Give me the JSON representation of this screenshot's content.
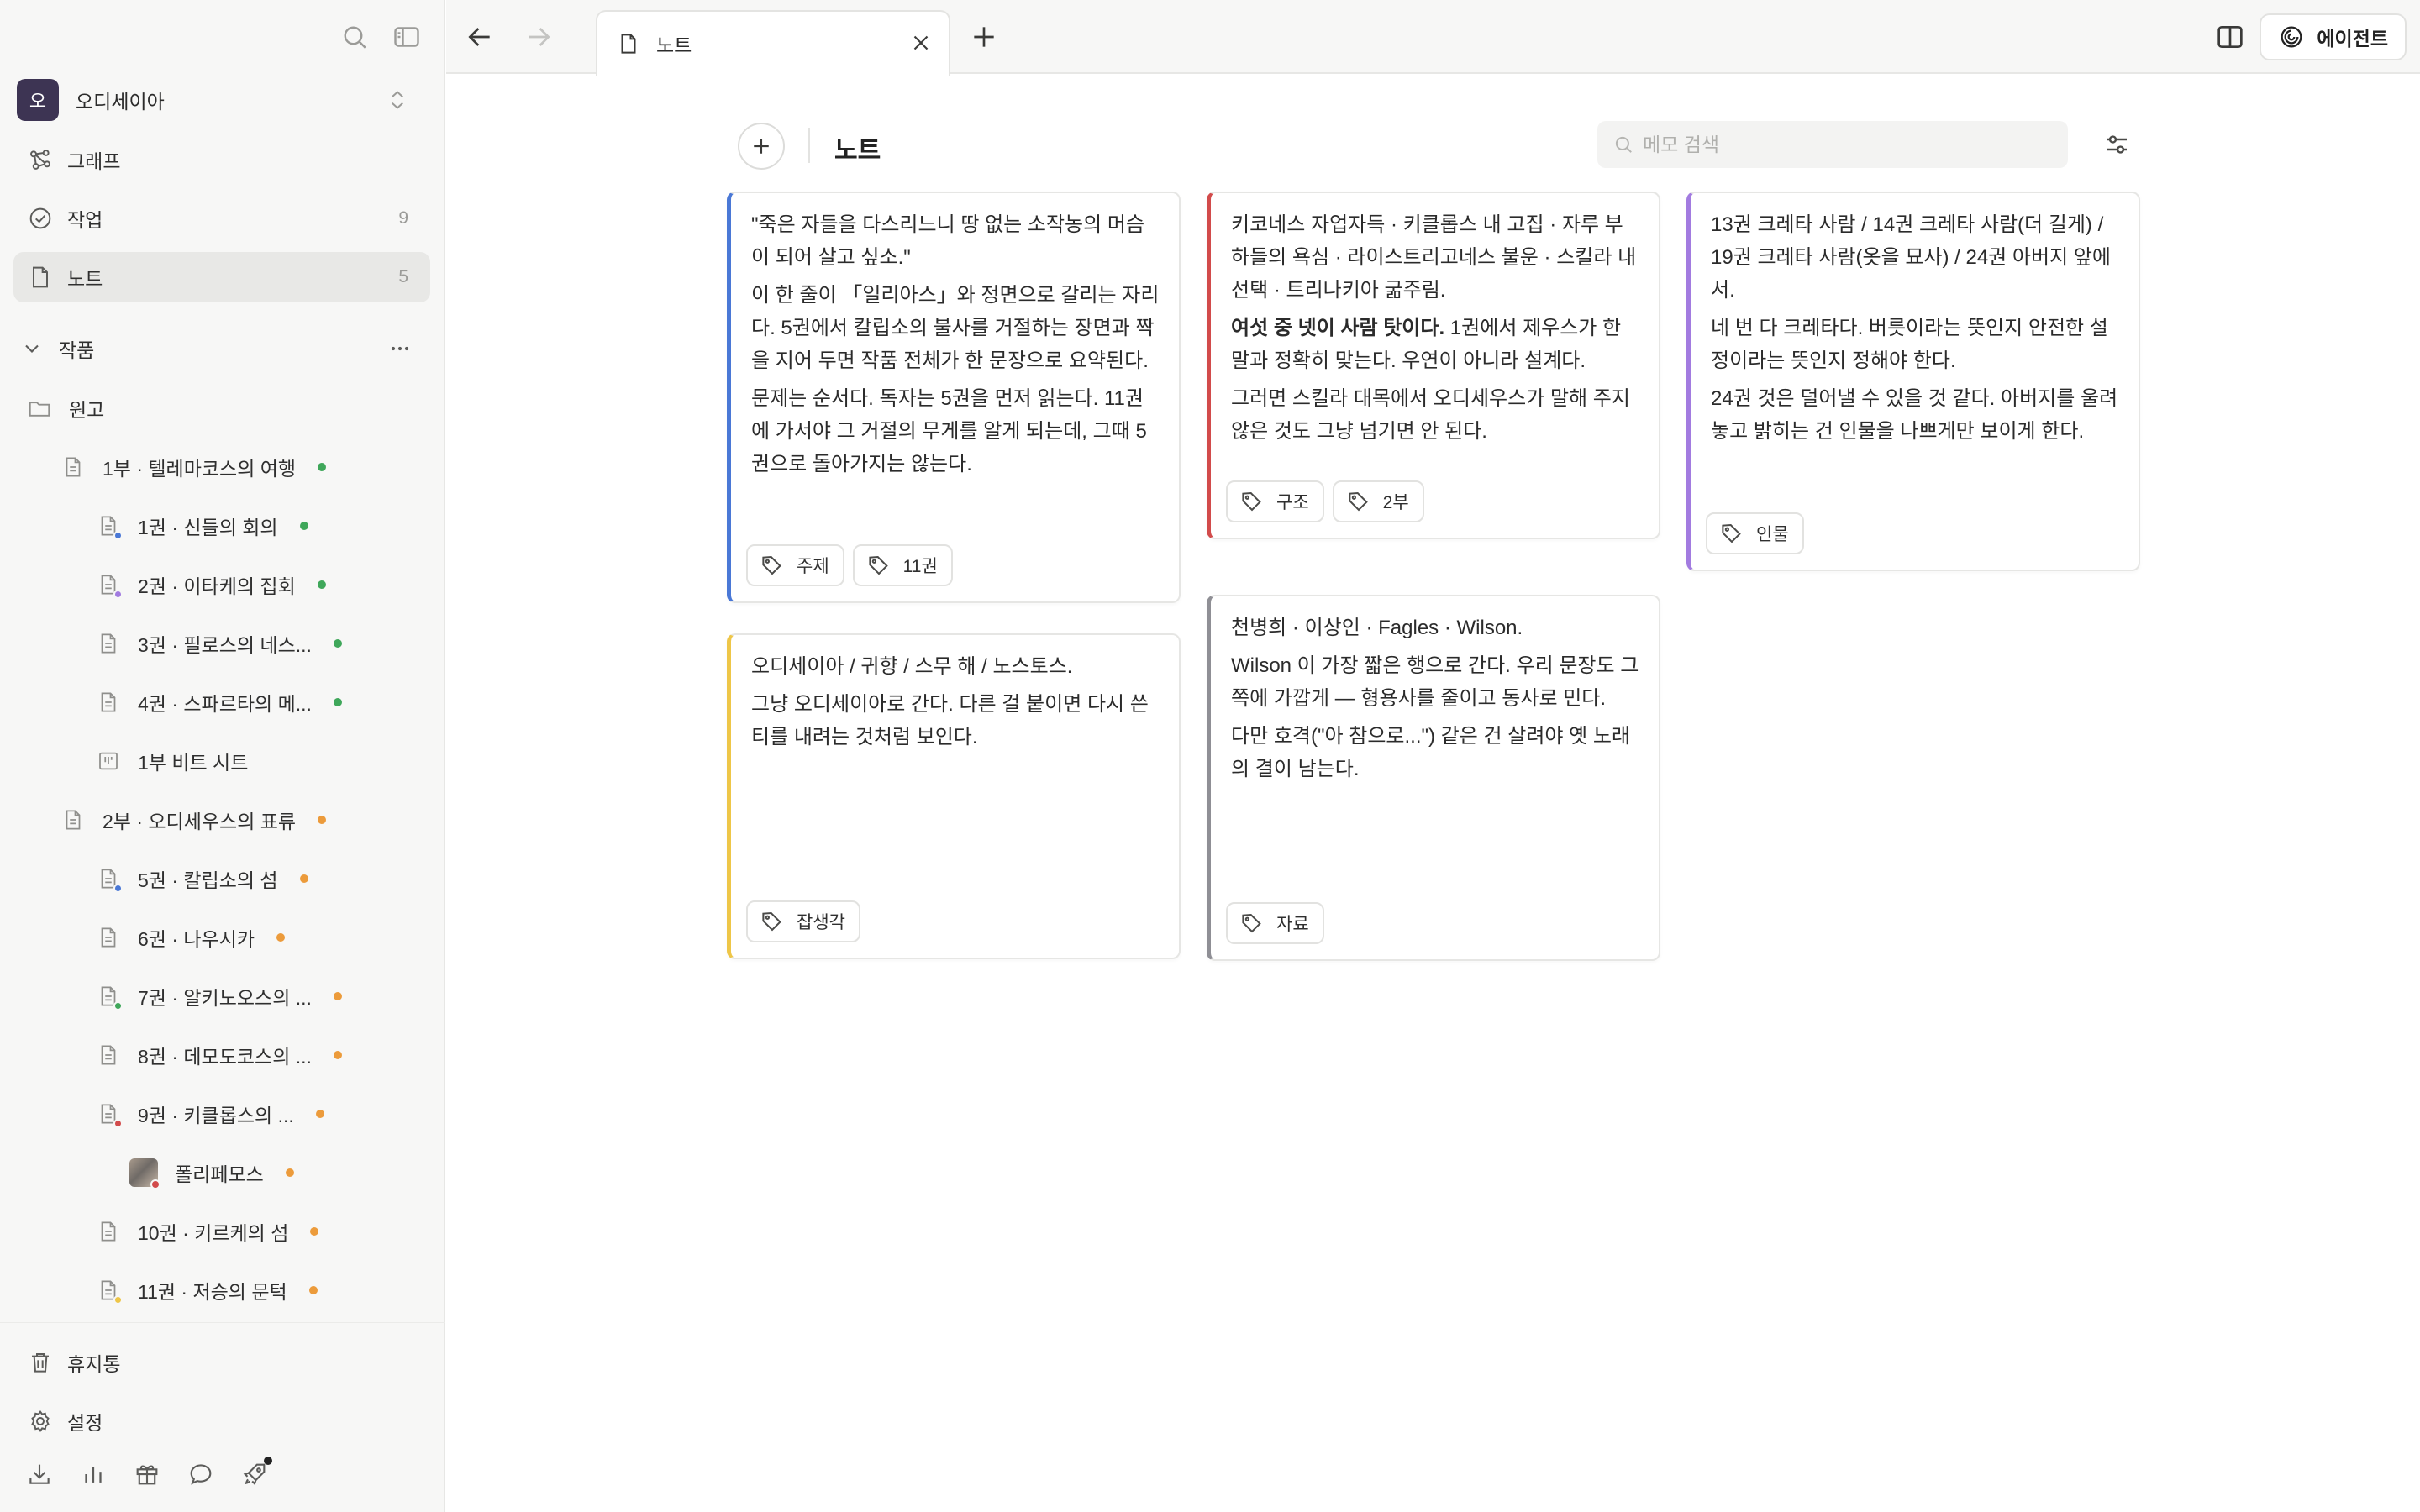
{
  "colors": {
    "blue": "#4a78d6",
    "red": "#d24b4b",
    "purple": "#a27be0",
    "yellow": "#eec648",
    "gray": "#8f8f95",
    "green": "#3fa75a",
    "orange": "#ec9b3b",
    "ws_avatar": "#3d3453"
  },
  "sidebar": {
    "workspace": {
      "avatar": "오",
      "name": "오디세이아"
    },
    "nav": [
      {
        "label": "그래프",
        "count": ""
      },
      {
        "label": "작업",
        "count": "9"
      },
      {
        "label": "노트",
        "count": "5"
      }
    ],
    "section": {
      "label": "작품"
    },
    "tree": [
      {
        "label": "원고"
      },
      {
        "label": "1부 · 텔레마코스의 여행"
      },
      {
        "label": "1권 · 신들의 회의"
      },
      {
        "label": "2권 · 이타케의 집회"
      },
      {
        "label": "3권 · 필로스의 네스..."
      },
      {
        "label": "4권 · 스파르타의 메..."
      },
      {
        "label": "1부 비트 시트"
      },
      {
        "label": "2부 · 오디세우스의 표류"
      },
      {
        "label": "5권 · 칼립소의 섬"
      },
      {
        "label": "6권 · 나우시카"
      },
      {
        "label": "7권 · 알키노오스의 ..."
      },
      {
        "label": "8권 · 데모도코스의 ..."
      },
      {
        "label": "9권 · 키클롭스의 ..."
      },
      {
        "label": "폴리페모스"
      },
      {
        "label": "10권 · 키르케의 섬"
      },
      {
        "label": "11권 · 저승의 문턱"
      }
    ],
    "footer": [
      {
        "label": "휴지통"
      },
      {
        "label": "설정"
      }
    ]
  },
  "topbar": {
    "tab_label": "노트",
    "agent_label": "에이전트"
  },
  "main": {
    "title": "노트",
    "search_placeholder": "메모 검색",
    "cards": [
      {
        "paragraphs": [
          "\"죽은 자들을 다스리느니 땅 없는 소작농의 머슴이 되어 살고 싶소.\"",
          "이 한 줄이 「일리아스」와 정면으로 갈리는 자리다. 5권에서 칼립소의 불사를 거절하는 장면과 짝을 지어 두면 작품 전체가 한 문장으로 요약된다.",
          "문제는 순서다. 독자는 5권을 먼저 읽는다. 11권에 가서야 그 거절의 무게를 알게 되는데, 그때 5권으로 돌아가지는 않는다."
        ],
        "tags": [
          "주제",
          "11권"
        ]
      },
      {
        "paragraphs": [
          "오디세이아 / 귀향 / 스무 해 / 노스토스.",
          "그냥 오디세이아로 간다. 다른 걸 붙이면 다시 쓴 티를 내려는 것처럼 보인다."
        ],
        "tags": [
          "잡생각"
        ]
      },
      {
        "paragraphs": [
          "키코네스 자업자득 · 키클롭스 내 고집 · 자루 부하들의 욕심 · 라이스트리고네스 불운 · 스킬라 내 선택 · 트리나키아 굶주림."
        ],
        "bold": "여섯 중 넷이 사람 탓이다.",
        "bold_rest": " 1권에서 제우스가 한 말과 정확히 맞는다. 우연이 아니라 설계다.",
        "after": "그러면 스킬라 대목에서 오디세우스가 말해 주지 않은 것도 그냥 넘기면 안 된다.",
        "tags": [
          "구조",
          "2부"
        ]
      },
      {
        "paragraphs": [
          "천병희 · 이상인 · Fagles · Wilson.",
          "Wilson 이 가장 짧은 행으로 간다. 우리 문장도 그쪽에 가깝게 — 형용사를 줄이고 동사로 민다.",
          "다만 호격(\"아 참으로...\") 같은 건 살려야 옛 노래의 결이 남는다."
        ],
        "tags": [
          "자료"
        ]
      },
      {
        "paragraphs": [
          "13권 크레타 사람 / 14권 크레타 사람(더 길게) / 19권 크레타 사람(옷을 묘사) / 24권 아버지 앞에서.",
          "네 번 다 크레타다. 버릇이라는 뜻인지 안전한 설정이라는 뜻인지 정해야 한다.",
          "24권 것은 덜어낼 수 있을 것 같다. 아버지를 울려 놓고 밝히는 건 인물을 나쁘게만 보이게 한다."
        ],
        "tags": [
          "인물"
        ]
      }
    ]
  }
}
